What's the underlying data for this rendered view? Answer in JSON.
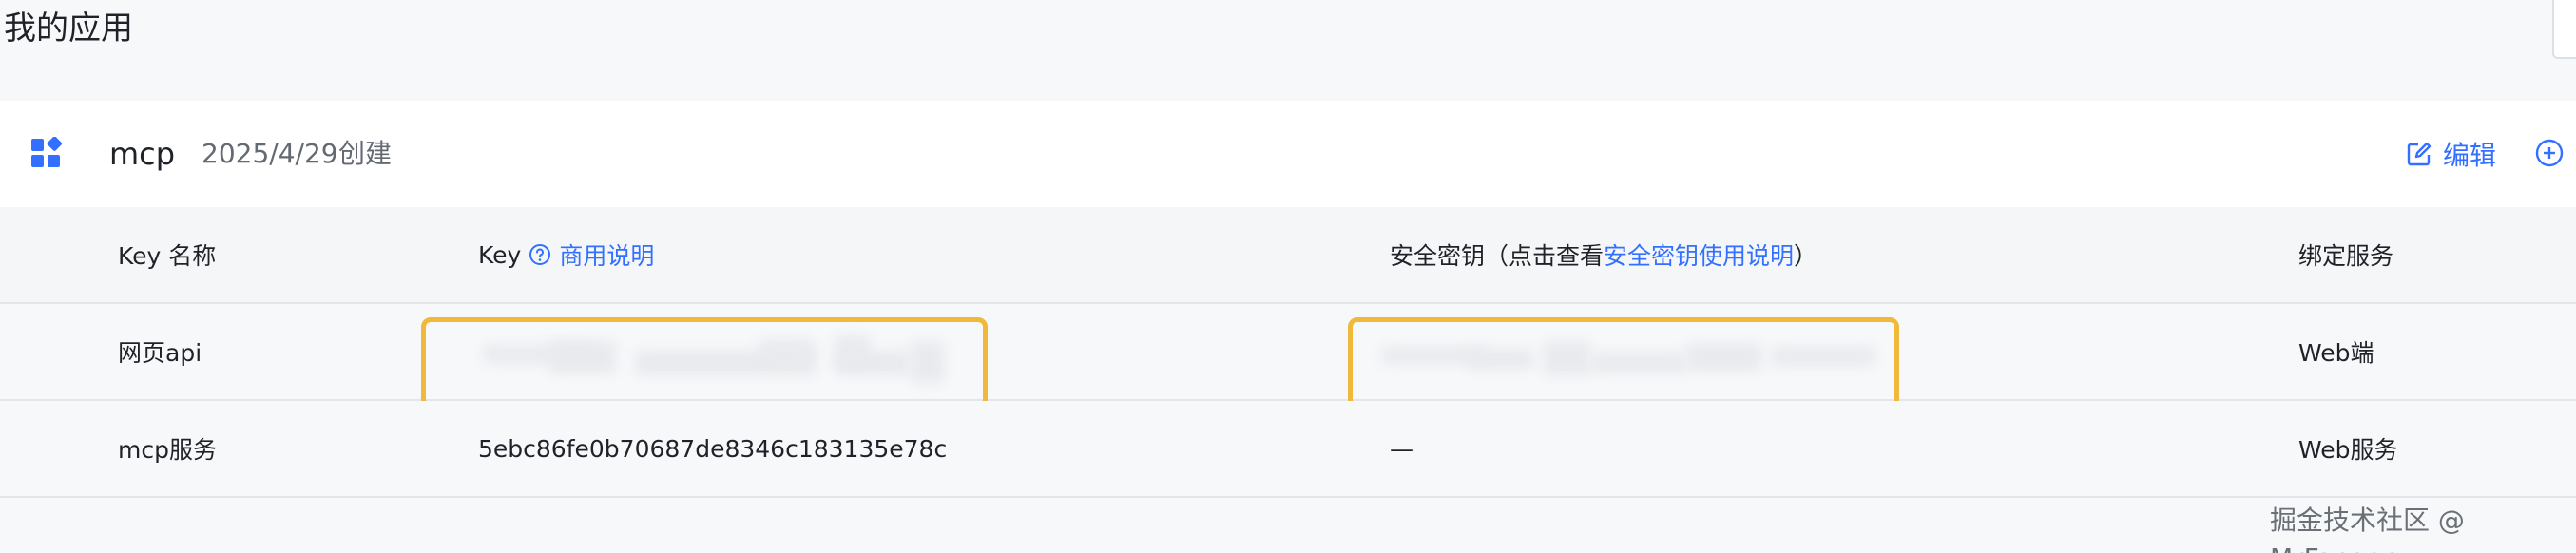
{
  "page": {
    "title": "我的应用"
  },
  "app": {
    "name": "mcp",
    "created_date": "2025/4/29",
    "created_label": "创建",
    "edit_label": "编辑"
  },
  "table": {
    "headers": {
      "key_name": "Key 名称",
      "key": "Key",
      "key_help_link": "商用说明",
      "secret_prefix": "安全密钥（点击查看",
      "secret_link": "安全密钥使用说明",
      "secret_suffix": "）",
      "service": "绑定服务"
    },
    "rows": [
      {
        "name": "网页api",
        "key": "",
        "secret": "",
        "service": "Web端"
      },
      {
        "name": "mcp服务",
        "key": "5ebc86fe0b70687de8346c183135e78c",
        "secret": "—",
        "service": "Web服务"
      }
    ]
  },
  "watermark": "掘金技术社区 @ MrFangge",
  "colors": {
    "accent": "#3370ff",
    "highlight_border": "#f0b93c",
    "background": "#f7f8fa"
  },
  "icons": {
    "app": "apps-grid-icon",
    "edit": "edit-icon",
    "add": "plus-circle-icon",
    "help": "question-circle-icon"
  }
}
